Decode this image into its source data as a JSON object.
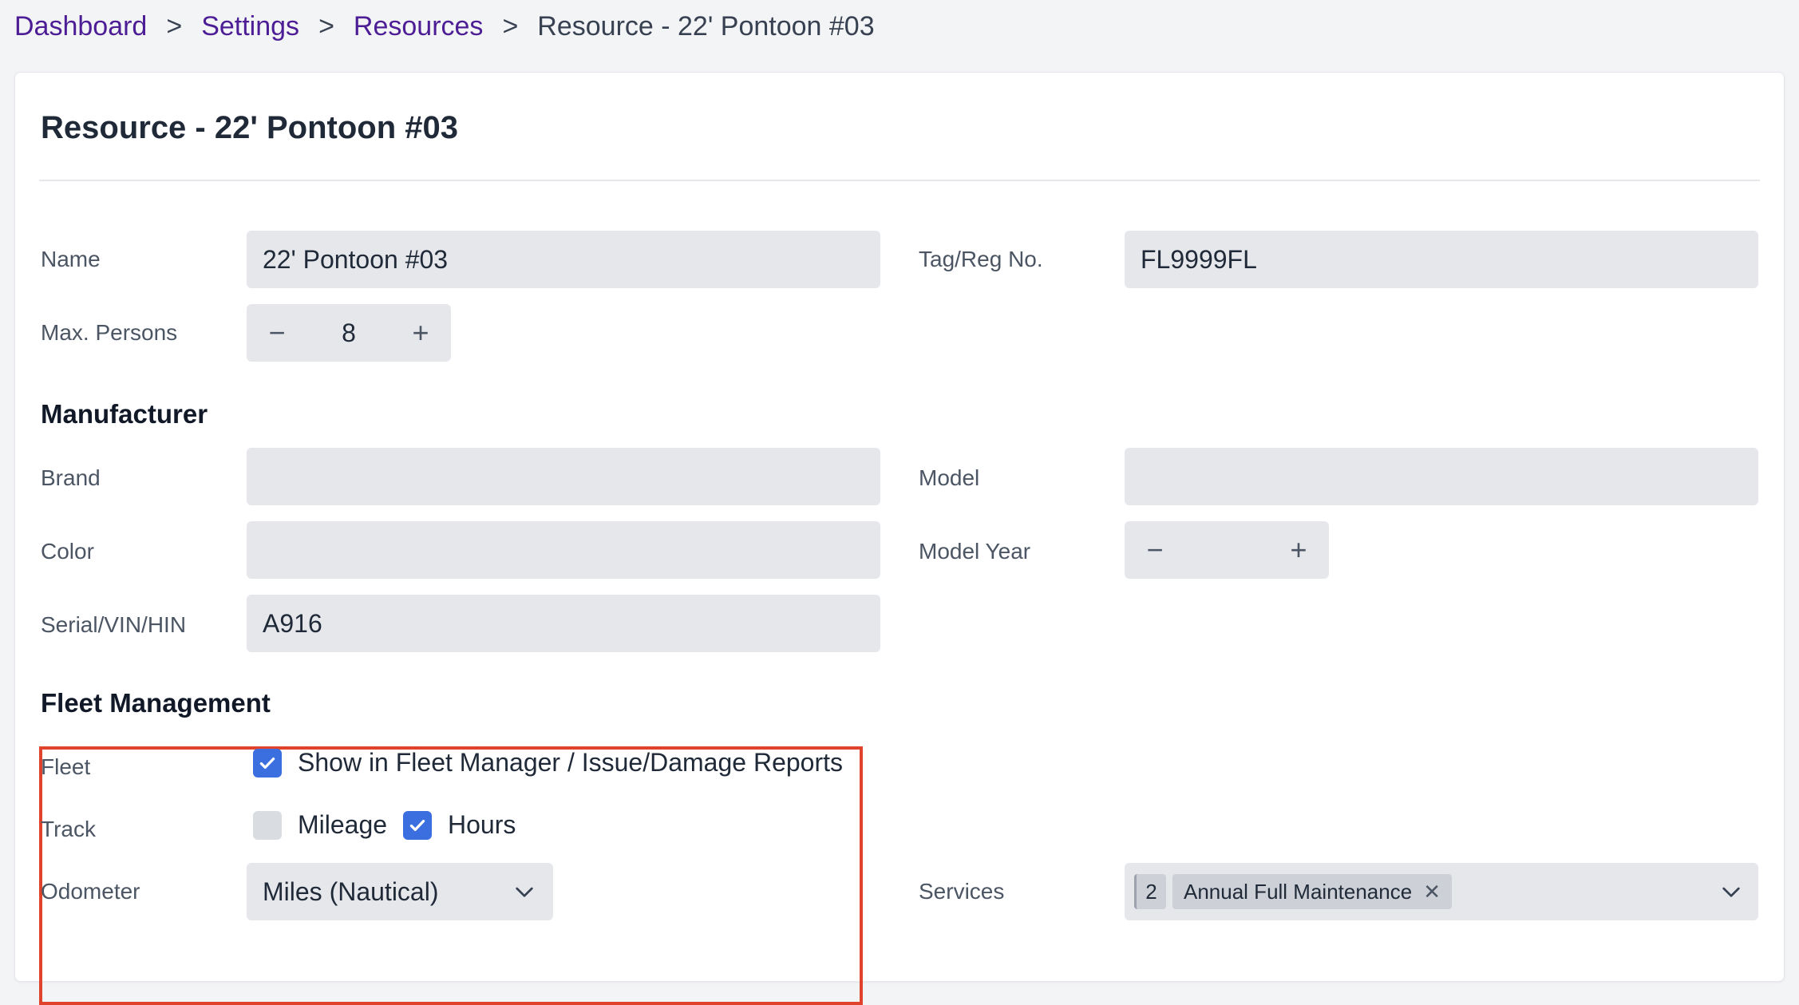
{
  "breadcrumb": {
    "items": [
      "Dashboard",
      "Settings",
      "Resources"
    ],
    "separator": ">",
    "current": "Resource - 22' Pontoon #03"
  },
  "page": {
    "title": "Resource - 22' Pontoon #03"
  },
  "fields": {
    "name": {
      "label": "Name",
      "value": "22' Pontoon #03"
    },
    "tag_reg": {
      "label": "Tag/Reg No.",
      "value": "FL9999FL"
    },
    "max_persons": {
      "label": "Max. Persons",
      "value": "8"
    }
  },
  "manufacturer": {
    "heading": "Manufacturer",
    "brand": {
      "label": "Brand",
      "value": ""
    },
    "model": {
      "label": "Model",
      "value": ""
    },
    "color": {
      "label": "Color",
      "value": ""
    },
    "model_year": {
      "label": "Model Year",
      "value": ""
    },
    "serial": {
      "label": "Serial/VIN/HIN",
      "value": "A916"
    }
  },
  "fleet_management": {
    "heading": "Fleet Management",
    "fleet": {
      "label": "Fleet",
      "option_label": "Show in Fleet Manager / Issue/Damage Reports",
      "checked": true
    },
    "track": {
      "label": "Track",
      "mileage": {
        "label": "Mileage",
        "checked": false
      },
      "hours": {
        "label": "Hours",
        "checked": true
      }
    },
    "odometer": {
      "label": "Odometer",
      "value": "Miles (Nautical)"
    },
    "services": {
      "label": "Services",
      "count": "2",
      "selected": [
        "Annual Full Maintenance"
      ]
    }
  },
  "icons": {
    "stepper_decrement": "minus-icon",
    "stepper_increment": "plus-icon",
    "dropdown": "chevron-down-icon",
    "tag_remove": "close-icon",
    "checkbox": "check-icon"
  },
  "colors": {
    "link": "#4c1d95",
    "accent": "#3b6fe0",
    "highlight": "#e0432c",
    "input_bg": "#e5e7eb"
  }
}
